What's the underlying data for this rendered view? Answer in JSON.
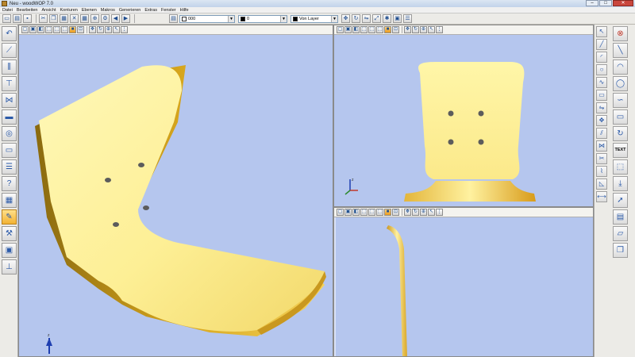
{
  "window": {
    "title": "Neu - woodWOP 7.0"
  },
  "menu": [
    "Datei",
    "Bearbeiten",
    "Ansicht",
    "Konturen",
    "Ebenen",
    "Makros",
    "Generieren",
    "Extras",
    "Fenster",
    "Hilfe"
  ],
  "toolbar": {
    "combo_value_1": "000",
    "combo_value_2": "0",
    "combo_layer": "Von Layer"
  },
  "right_tools": {
    "text_button": "TEXT"
  },
  "colors": {
    "viewport_bg": "#b5c6ee",
    "part_yellow": "#fef49a",
    "part_edge": "#d6a51c"
  },
  "icons": {
    "left_tools": [
      "contour-icon",
      "trim-icon",
      "drill-icon",
      "router-icon",
      "sawblade-icon",
      "pocket-icon",
      "circle-icon",
      "frame-icon",
      "document-icon",
      "help-icon",
      "component-icon",
      "edit-tool-icon",
      "robot-icon",
      "monitor-icon",
      "axis-icon"
    ],
    "right_tools_col1": [
      "select-icon",
      "line-icon",
      "arc-icon",
      "circle-icon",
      "spline-icon",
      "rect-icon",
      "mirror-icon",
      "move-icon",
      "offset-icon",
      "join-icon",
      "trim-icon",
      "break-icon",
      "chamfer-icon",
      "measure-icon"
    ],
    "right_tools_col2": [
      "close-icon",
      "line-icon",
      "arc-icon",
      "circle-icon",
      "spline-icon",
      "rectangle-icon",
      "rotate-icon",
      "text-icon",
      "3d-box-icon",
      "insert-icon",
      "arrow-icon",
      "layer-icon",
      "plane-icon",
      "copy-icon"
    ]
  }
}
